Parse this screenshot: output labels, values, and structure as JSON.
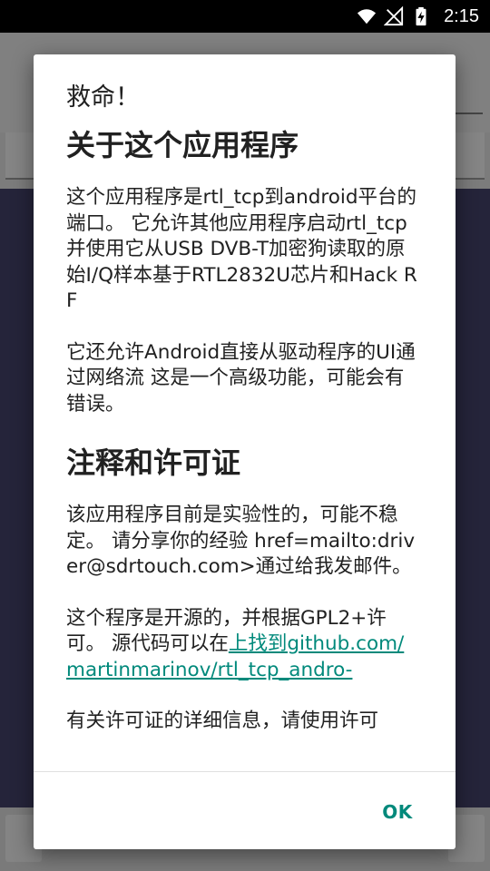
{
  "status_bar": {
    "time": "2:15",
    "icons": [
      "wifi-icon",
      "no-signal-icon",
      "battery-charging-icon"
    ]
  },
  "dialog": {
    "title": "救命！",
    "sections": [
      {
        "heading": "关于这个应用程序",
        "paragraphs": [
          "这个应用程序是rtl_tcp到android平台的端口。 它允许其他应用程序启动rtl_tcp并使用它从USB DVB-T加密狗读取的原始I/Q样本基于RTL2832U芯片和Hack RF",
          "它还允许Android直接从驱动程序的UI通过网络流 这是一个高级功能，可能会有错误。"
        ]
      },
      {
        "heading": "注释和许可证",
        "paragraphs": [
          "该应用程序目前是实验性的，可能不稳定。 请分享你的经验 href=mailto:driver@sdrtouch.com>通过给我发邮件。"
        ],
        "license_text": "这个程序是开源的，并根据GPL2+许可。 源代码可以在",
        "license_link": "上找到github.com/martinmarinov/rtl_tcp_andro-",
        "details_text": "有关许可证的详细信息，请使用许可"
      }
    ],
    "ok_label": "OK"
  },
  "colors": {
    "accent": "#00897b",
    "text": "#212121",
    "scrim": "#7a7a7a",
    "app_content": "#25243a"
  }
}
